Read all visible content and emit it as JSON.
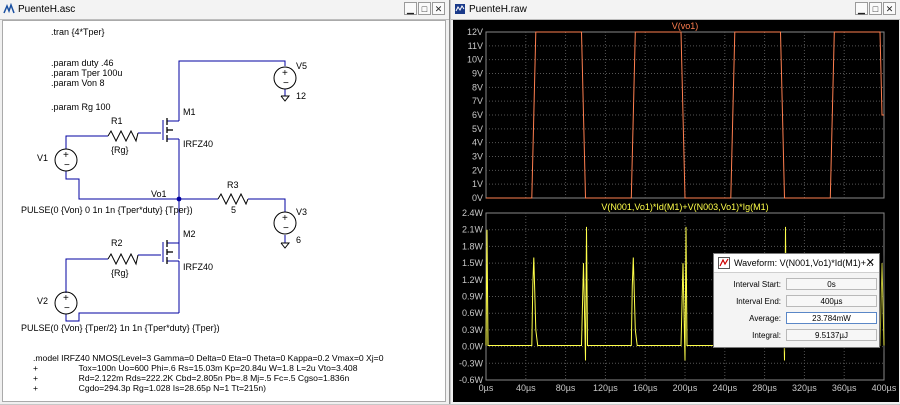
{
  "colors": {
    "trace1": "#ff7f50",
    "trace2": "#ffff4a",
    "grid": "#555555",
    "axis_text": "#c8c8c8",
    "wire": "#000080"
  },
  "left_window": {
    "title": "PuenteH.asc"
  },
  "right_window": {
    "title": "PuenteH.raw"
  },
  "window_buttons": {
    "minimize": "▁",
    "maximize": "□",
    "close": "✕"
  },
  "schematic": {
    "directives": [
      ".tran {4*Tper}",
      ".param duty .46",
      ".param Tper  100u",
      ".param Von 8",
      ".param Rg 100"
    ],
    "labels": {
      "m1": "M1",
      "m1_part": "IRFZ40",
      "m2": "M2",
      "m2_part": "IRFZ40",
      "r1": "R1",
      "r1_val": "{Rg}",
      "r2": "R2",
      "r2_val": "{Rg}",
      "r3": "R3",
      "r3_val": "5",
      "v1": "V1",
      "v2": "V2",
      "v3": "V3",
      "v3_val": "6",
      "v5": "V5",
      "v5_val": "12",
      "node": "Vo1"
    },
    "pulse1": "PULSE(0 {Von} 0 1n 1n {Tper*duty} {Tper})",
    "pulse2": "PULSE(0 {Von} {Tper/2} 1n 1n {Tper*duty} {Tper})",
    "model": [
      ".model IRFZ40   NMOS(Level=3 Gamma=0 Delta=0 Eta=0 Theta=0 Kappa=0.2 Vmax=0 Xj=0",
      "+                 Tox=100n Uo=600 Phi=.6 Rs=15.03m Kp=20.84u W=1.8 L=2u Vto=3.408",
      "+                 Rd=2.122m Rds=222.2K Cbd=2.805n Pb=.8 Mj=.5 Fc=.5 Cgso=1.836n",
      "+                 Cgdo=294.3p Rg=1.028 Is=28.65p N=1 Tt=215n)"
    ]
  },
  "plot1": {
    "title": "V(vo1)",
    "y_ticks": [
      "12V",
      "11V",
      "10V",
      "9V",
      "8V",
      "7V",
      "6V",
      "5V",
      "4V",
      "3V",
      "2V",
      "1V",
      "0V"
    ],
    "y_range": [
      0,
      12
    ]
  },
  "plot2": {
    "title": "V(N001,Vo1)*Id(M1)+V(N003,Vo1)*Ig(M1)",
    "y_ticks": [
      "2.4W",
      "2.1W",
      "1.8W",
      "1.5W",
      "1.2W",
      "0.9W",
      "0.6W",
      "0.3W",
      "0.0W",
      "-0.3W",
      "-0.6W"
    ],
    "y_range": [
      -0.6,
      2.4
    ]
  },
  "x_ticks": [
    "0µs",
    "40µs",
    "80µs",
    "120µs",
    "160µs",
    "200µs",
    "240µs",
    "280µs",
    "320µs",
    "360µs",
    "400µs"
  ],
  "chart_data": [
    {
      "type": "line",
      "title": "V(vo1)",
      "x_unit": "µs",
      "xlim": [
        0,
        400
      ],
      "ylim": [
        0,
        12
      ],
      "series": [
        {
          "name": "V(vo1)",
          "x": [
            0,
            46,
            48,
            50,
            96,
            98,
            100,
            146,
            148,
            150,
            196,
            198,
            200,
            246,
            248,
            250,
            296,
            298,
            300,
            346,
            348,
            350,
            396,
            398,
            400
          ],
          "y": [
            0,
            0,
            6,
            12,
            12,
            6,
            0,
            0,
            6,
            12,
            12,
            6,
            0,
            0,
            6,
            12,
            12,
            6,
            0,
            0,
            6,
            12,
            12,
            6,
            6
          ]
        }
      ]
    },
    {
      "type": "line",
      "title": "V(N001,Vo1)*Id(M1)+V(N003,Vo1)*Ig(M1)",
      "x_unit": "µs",
      "xlim": [
        0,
        400
      ],
      "ylim": [
        -0.6,
        2.4
      ],
      "series": [
        {
          "name": "V(N001,Vo1)*Id(M1)+V(N003,Vo1)*Ig(M1)",
          "x": [
            0,
            1,
            2,
            20,
            46,
            47,
            48,
            50,
            52,
            96,
            98,
            100,
            101,
            102,
            146,
            147,
            148,
            150,
            152,
            196,
            198,
            200,
            201,
            202,
            246,
            247,
            248,
            250,
            252,
            296,
            298,
            300,
            301,
            302,
            346,
            347,
            348,
            350,
            352,
            396,
            398,
            400
          ],
          "y": [
            0.02,
            2.1,
            0.02,
            0.02,
            0.02,
            1.1,
            1.6,
            0.3,
            0.02,
            0.02,
            1.5,
            -0.25,
            2.15,
            0.02,
            0.02,
            1.1,
            1.6,
            0.3,
            0.02,
            0.02,
            1.5,
            -0.25,
            2.15,
            0.02,
            0.02,
            1.1,
            1.6,
            0.3,
            0.02,
            0.02,
            1.5,
            -0.25,
            2.15,
            0.02,
            0.02,
            1.1,
            1.6,
            0.3,
            0.02,
            0.02,
            1.5,
            0.02
          ]
        }
      ]
    }
  ],
  "waveform_dialog": {
    "title": "Waveform: V(N001,Vo1)*Id(M1)+...",
    "close": "✕",
    "rows": [
      {
        "label": "Interval Start:",
        "value": "0s"
      },
      {
        "label": "Interval End:",
        "value": "400µs"
      },
      {
        "label": "Average:",
        "value": "23.784mW"
      },
      {
        "label": "Integral:",
        "value": "9.5137µJ"
      }
    ]
  }
}
